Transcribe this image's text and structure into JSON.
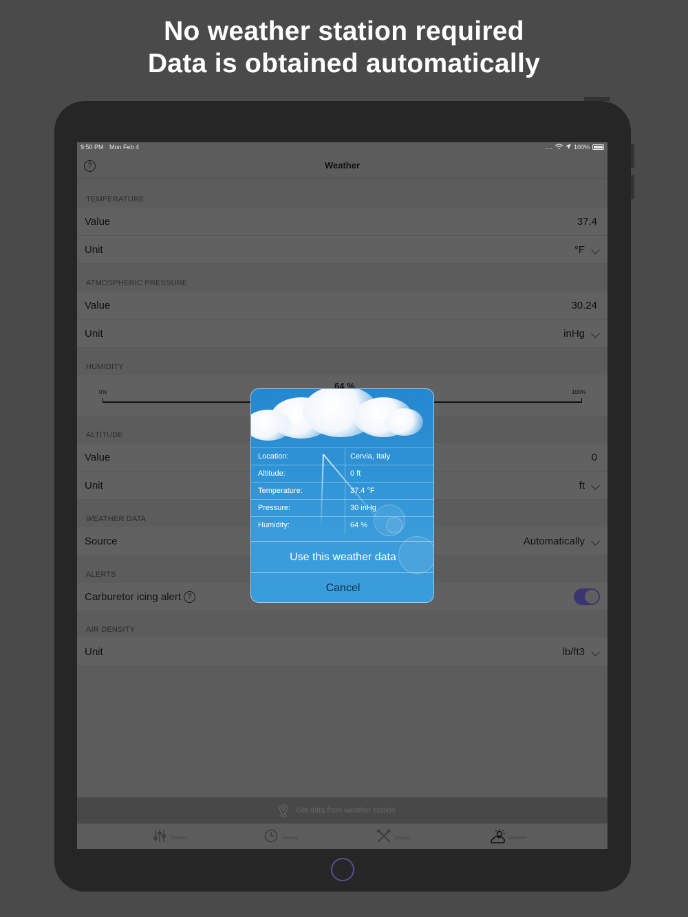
{
  "headline": [
    "No weather station required",
    "Data is obtained automatically"
  ],
  "status": {
    "time": "9:50 PM",
    "date": "Mon Feb 4",
    "signal": "....",
    "battery": "100%"
  },
  "nav": {
    "title": "Weather",
    "help_glyph": "?"
  },
  "sections": {
    "temperature": {
      "header": "TEMPERATURE",
      "value_label": "Value",
      "value": "37.4",
      "unit_label": "Unit",
      "unit": "°F"
    },
    "pressure": {
      "header": "ATMOSPHERIC PRESSURE",
      "value_label": "Value",
      "value": "30.24",
      "unit_label": "Unit",
      "unit": "inHg"
    },
    "humidity": {
      "header": "HUMIDITY",
      "min": "0%",
      "max": "100%",
      "value": "64 %",
      "level": 0.64
    },
    "altitude": {
      "header": "ALTITUDE",
      "value_label": "Value",
      "value": "0",
      "unit_label": "Unit",
      "unit": "ft"
    },
    "weather_data": {
      "header": "WEATHER DATA",
      "source_label": "Source",
      "source": "Automatically"
    },
    "alerts": {
      "header": "ALERTS",
      "icing_label": "Carburetor icing alert",
      "icing_enabled": true
    },
    "air_density": {
      "header": "AIR DENSITY",
      "unit_label": "Unit",
      "unit": "lb/ft3"
    }
  },
  "station_bar": {
    "label": "Get data from weather station",
    "icon": "location-pin-icon"
  },
  "tabs": [
    {
      "label": "Results",
      "icon": "sliders-icon"
    },
    {
      "label": "History",
      "icon": "clock-icon"
    },
    {
      "label": "Engine",
      "icon": "tools-icon"
    },
    {
      "label": "Weather",
      "icon": "cloud-sun-icon"
    }
  ],
  "dialog": {
    "rows": [
      {
        "key": "Location:",
        "value": "Cervia, Italy"
      },
      {
        "key": "Altitude:",
        "value": "0 ft"
      },
      {
        "key": "Temperature:",
        "value": "37.4 °F"
      },
      {
        "key": "Pressure:",
        "value": "30 inHg"
      },
      {
        "key": "Humidity:",
        "value": "64 %"
      }
    ],
    "use_label": "Use this weather data",
    "cancel_label": "Cancel"
  },
  "colors": {
    "accent": "#3a3472",
    "dialog_blue": "#2f93d6",
    "background": "#4a4a4a"
  }
}
